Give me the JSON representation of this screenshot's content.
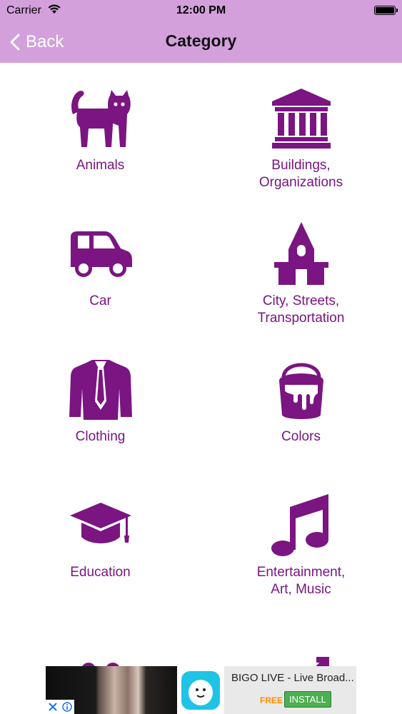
{
  "status_bar": {
    "carrier": "Carrier",
    "time": "12:00 PM"
  },
  "nav": {
    "back_label": "Back",
    "title": "Category"
  },
  "categories": [
    {
      "label": "Animals",
      "icon": "cat-icon"
    },
    {
      "label": "Buildings,\nOrganizations",
      "icon": "bank-building-icon"
    },
    {
      "label": "Car",
      "icon": "car-icon"
    },
    {
      "label": "City, Streets,\nTransportation",
      "icon": "church-house-icon"
    },
    {
      "label": "Clothing",
      "icon": "suit-jacket-icon"
    },
    {
      "label": "Colors",
      "icon": "paint-bucket-icon"
    },
    {
      "label": "Education",
      "icon": "graduation-cap-icon"
    },
    {
      "label": "Entertainment,\nArt, Music",
      "icon": "music-note-icon"
    },
    {
      "label": "",
      "icon": "people-icon"
    },
    {
      "label": "",
      "icon": "gender-symbols-icon"
    }
  ],
  "ad": {
    "title": "BIGO LIVE - Live Broad...",
    "price": "FREE",
    "cta": "INSTALL"
  },
  "colors": {
    "nav_bg": "#d3a0dc",
    "accent": "#7a1582",
    "icon": "#7a1582"
  }
}
